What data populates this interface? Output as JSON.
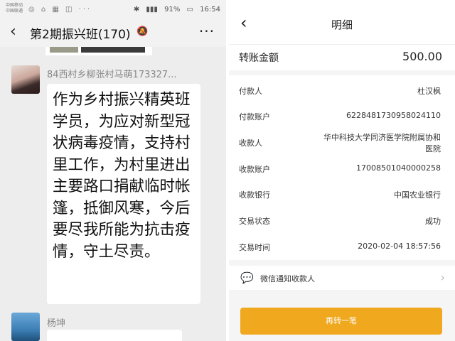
{
  "chat": {
    "statusbar": {
      "carrier_line1": "中国移动",
      "carrier_line2": "中国联通",
      "icons": "◎ ⌂ ▦ ◫ ···",
      "battery": "91%",
      "time": "16:54"
    },
    "header": {
      "back_icon": "‹",
      "title": "第2期振兴班(170)",
      "mute_icon": "🔕",
      "more_icon": "···"
    },
    "message": {
      "sender": "84西村乡柳张村马萌173327...",
      "text": "作为乡村振兴精英班学员，为应对新型冠状病毒疫情，支持村里工作，为村里进出主要路口捐献临时帐篷，抵御风寒，今后要尽我所能为抗击疫情，守土尽责。"
    },
    "next_message": {
      "sender": "杨坤"
    }
  },
  "detail": {
    "header": {
      "back_icon": "‹",
      "title": "明细"
    },
    "amount": {
      "label": "转账金额",
      "value": "500.00"
    },
    "rows": [
      {
        "key": "付款人",
        "value": "杜汉枫"
      },
      {
        "key": "付款账户",
        "value": "6228481730958024110"
      },
      {
        "key": "收款人",
        "value_line1": "华中科技大学同济医学院附属协和",
        "value_line2": "医院"
      },
      {
        "key": "收款账户",
        "value": "17008501040000258"
      },
      {
        "key": "收款银行",
        "value": "中国农业银行"
      },
      {
        "key": "交易状态",
        "value": "成功"
      },
      {
        "key": "交易时间",
        "value": "2020-02-04 18:57:56"
      }
    ],
    "notify": {
      "icon": "wechat-icon",
      "label": "微信通知收款人",
      "chevron": "›"
    },
    "primary_button": "再转一笔",
    "accent_color": "#f0a81e"
  }
}
